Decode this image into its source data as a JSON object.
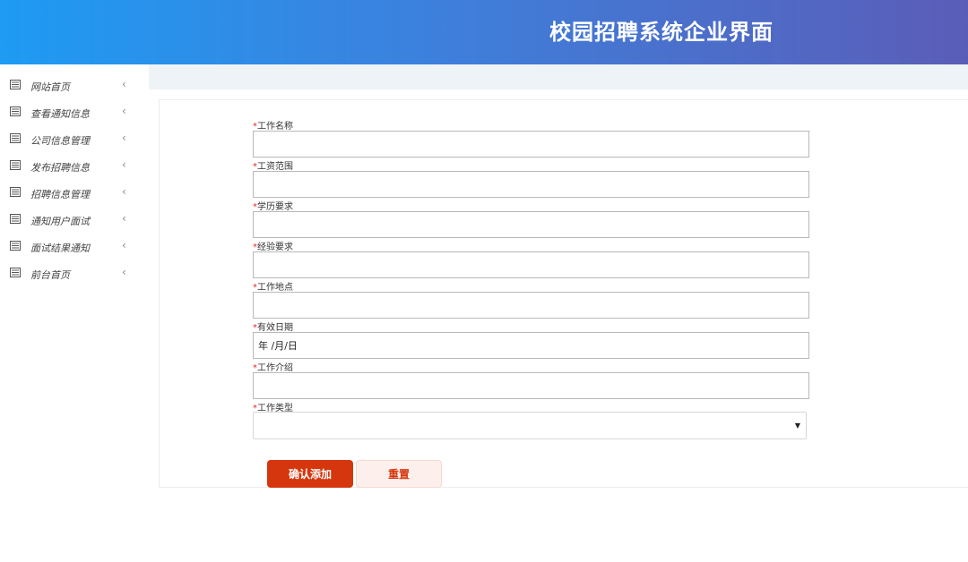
{
  "header": {
    "title": "校园招聘系统企业界面"
  },
  "sidebar": {
    "items": [
      {
        "label": "网站首页",
        "icon": "list-icon"
      },
      {
        "label": "查看通知信息",
        "icon": "list-icon"
      },
      {
        "label": "公司信息管理",
        "icon": "list-icon"
      },
      {
        "label": "发布招聘信息",
        "icon": "list-icon"
      },
      {
        "label": "招聘信息管理",
        "icon": "list-icon"
      },
      {
        "label": "通知用户面试",
        "icon": "list-icon"
      },
      {
        "label": "面试结果通知",
        "icon": "list-icon"
      },
      {
        "label": "前台首页",
        "icon": "list-icon"
      }
    ],
    "chevron": "‹"
  },
  "form": {
    "required_mark": "*",
    "fields": {
      "job_name": {
        "label": "工作名称",
        "value": ""
      },
      "salary_range": {
        "label": "工资范围",
        "value": ""
      },
      "education": {
        "label": "学历要求",
        "value": ""
      },
      "experience": {
        "label": "经验要求",
        "value": ""
      },
      "location": {
        "label": "工作地点",
        "value": ""
      },
      "valid_date": {
        "label": "有效日期",
        "value": "年 /月/日"
      },
      "description": {
        "label": "工作介绍",
        "value": ""
      },
      "job_type": {
        "label": "工作类型",
        "value": ""
      }
    },
    "submit_label": "确认添加",
    "reset_label": "重置"
  },
  "colors": {
    "header_start": "#1e9bf3",
    "header_end": "#5a5db8",
    "primary": "#d5360e",
    "required": "#e0281c"
  }
}
